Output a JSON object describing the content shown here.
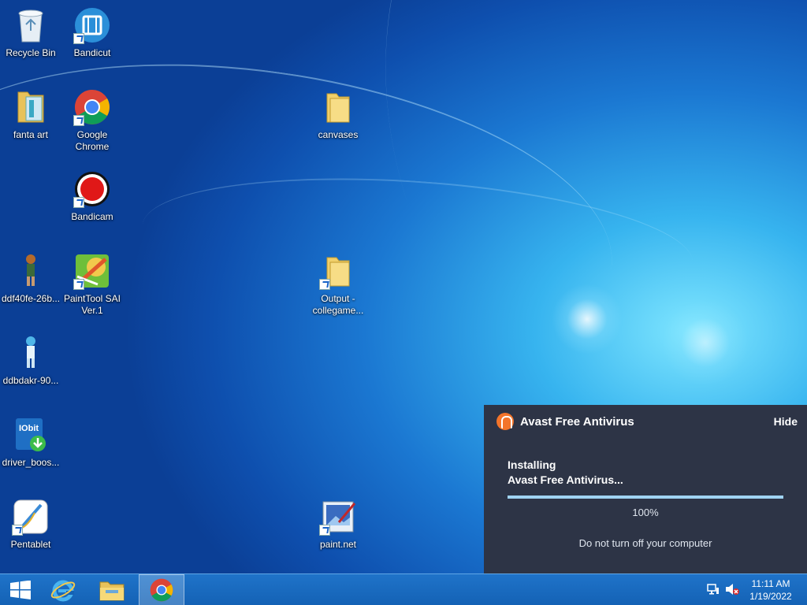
{
  "desktop": {
    "icons": [
      {
        "label": "Recycle Bin",
        "icon": "recycle-bin-icon"
      },
      {
        "label": "Bandicut",
        "icon": "bandicut-icon"
      },
      {
        "label": "fanta art",
        "icon": "folder-icon"
      },
      {
        "label": "Google Chrome",
        "icon": "chrome-icon"
      },
      {
        "label": "canvases",
        "icon": "folder-icon"
      },
      {
        "label": "Bandicam",
        "icon": "bandicam-icon"
      },
      {
        "label": "ddf40fe-26b...",
        "icon": "image-file-icon"
      },
      {
        "label": "PaintTool SAI Ver.1",
        "icon": "painttool-sai-icon"
      },
      {
        "label": "Output - collegame...",
        "icon": "folder-shortcut-icon"
      },
      {
        "label": "ddbdakr-90...",
        "icon": "image-file-icon"
      },
      {
        "label": "driver_boos...",
        "icon": "driver-booster-icon"
      },
      {
        "label": "Pentablet",
        "icon": "pentablet-icon"
      },
      {
        "label": "paint.net",
        "icon": "paint-net-icon"
      }
    ]
  },
  "avast": {
    "title": "Avast Free Antivirus",
    "hide_label": "Hide",
    "status_line1": "Installing",
    "status_line2": "Avast Free Antivirus...",
    "progress": 1.0,
    "progress_text": "100%",
    "note": "Do not turn off your computer",
    "accent": "#f3742a"
  },
  "taskbar": {
    "start": "windows-start-icon",
    "pinned": [
      "internet-explorer-icon",
      "file-explorer-icon",
      "chrome-icon"
    ],
    "tray": [
      "network-icon",
      "volume-muted-icon"
    ],
    "time": "11:11 AM",
    "date": "1/19/2022"
  }
}
